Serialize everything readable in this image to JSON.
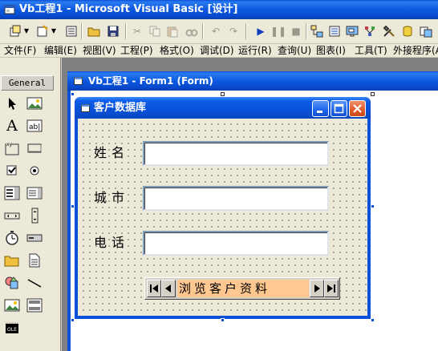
{
  "app": {
    "title": "Vb工程1 - Microsoft Visual Basic [设计]"
  },
  "menu": {
    "items": [
      "文件(F)",
      "编辑(E)",
      "视图(V)",
      "工程(P)",
      "格式(O)",
      "调试(D)",
      "运行(R)",
      "查询(U)",
      "图表(I)",
      "工具(T)",
      "外接程序(A)"
    ]
  },
  "toolbox": {
    "tab_label": "General"
  },
  "designer": {
    "title": "Vb工程1 - Form1 (Form)"
  },
  "form": {
    "caption": "客户数据库",
    "fields": [
      {
        "label": "姓名",
        "value": ""
      },
      {
        "label": "城市",
        "value": ""
      },
      {
        "label": "电话",
        "value": ""
      }
    ],
    "data_control": {
      "caption": "浏览客户资料",
      "caption_bg": "#ffc891"
    }
  },
  "colors": {
    "xp_blue": "#0a50d8",
    "chrome": "#ece9d8",
    "close_red": "#e05a28"
  }
}
